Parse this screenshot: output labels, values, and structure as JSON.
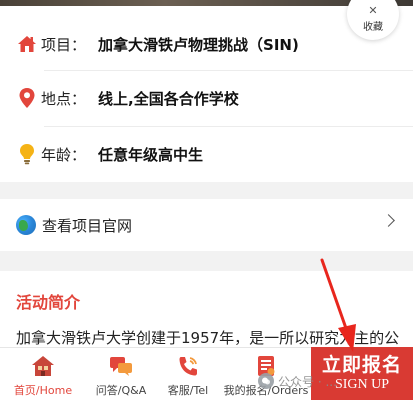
{
  "favorite": {
    "label": "收藏",
    "icon": "star-icon"
  },
  "info": {
    "project": {
      "label": "项目：",
      "value": "加拿大滑铁卢物理挑战（SIN)",
      "icon": "house-icon"
    },
    "location": {
      "label": "地点：",
      "value": "线上,全国各合作学校",
      "icon": "map-pin-icon"
    },
    "age": {
      "label": "年龄：",
      "value": "任意年级高中生",
      "icon": "lightbulb-icon"
    }
  },
  "official_link": {
    "label": "查看项目官网",
    "icon": "globe-icon"
  },
  "intro": {
    "title": "活动简介",
    "text": "加拿大滑铁卢大学创建于1957年，是一所以研究为主的公"
  },
  "bottom_nav": {
    "items": [
      {
        "label": "首页/Home",
        "icon": "home-icon",
        "active": true
      },
      {
        "label": "问答/Q&A",
        "icon": "chat-icon",
        "active": false
      },
      {
        "label": "客服/Tel",
        "icon": "phone-icon",
        "active": false
      },
      {
        "label": "我的报名/Orders",
        "icon": "orders-icon",
        "active": false
      }
    ]
  },
  "signup": {
    "label_cn": "立即报名",
    "label_en": "SIGN UP"
  },
  "watermark": {
    "text": "公众号 · ..."
  },
  "colors": {
    "accent": "#e2463c",
    "signup_bg": "#d93a33"
  }
}
